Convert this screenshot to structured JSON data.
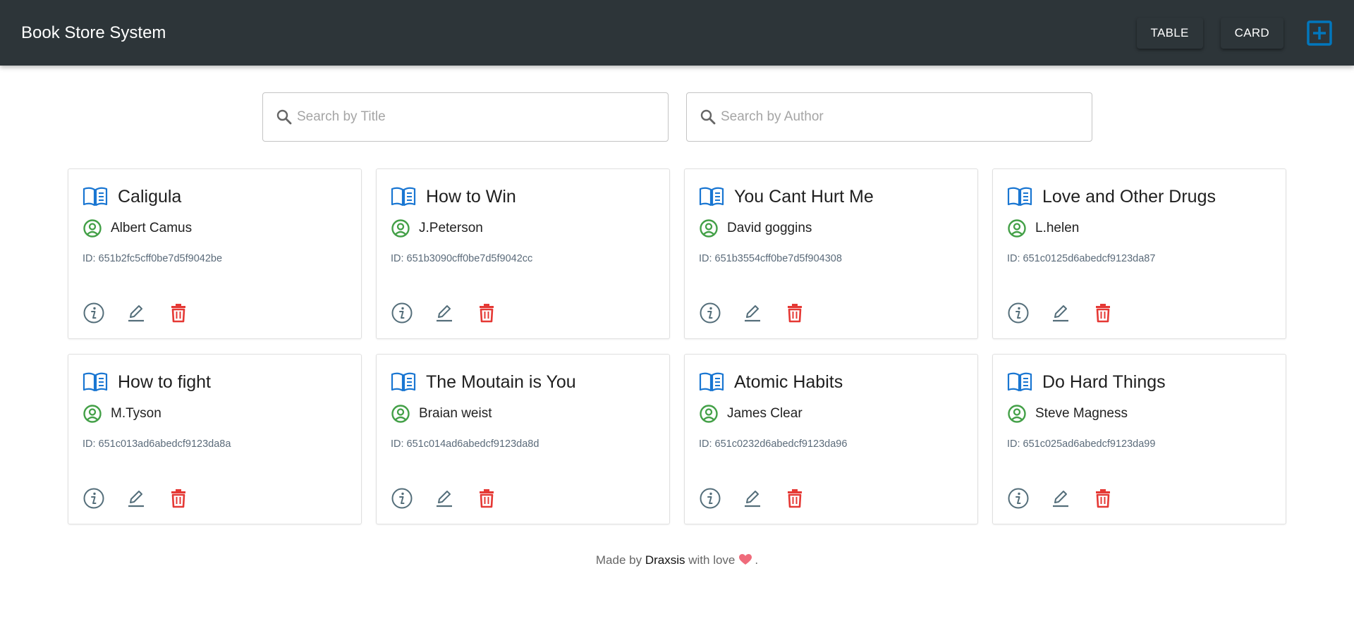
{
  "app": {
    "title": "Book Store System",
    "nav": {
      "table_label": "TABLE",
      "card_label": "CARD"
    }
  },
  "search": {
    "title_placeholder": "Search by Title",
    "author_placeholder": "Search by Author"
  },
  "books": [
    {
      "title": "Caligula",
      "author": "Albert Camus",
      "id_label": "ID:",
      "id": "651b2fc5cff0be7d5f9042be"
    },
    {
      "title": "How to Win",
      "author": "J.Peterson",
      "id_label": "ID:",
      "id": "651b3090cff0be7d5f9042cc"
    },
    {
      "title": "You Cant Hurt Me",
      "author": "David goggins",
      "id_label": "ID:",
      "id": "651b3554cff0be7d5f904308"
    },
    {
      "title": "Love and Other Drugs",
      "author": "L.helen",
      "id_label": "ID:",
      "id": "651c0125d6abedcf9123da87"
    },
    {
      "title": "How to fight",
      "author": "M.Tyson",
      "id_label": "ID:",
      "id": "651c013ad6abedcf9123da8a"
    },
    {
      "title": "The Moutain is You",
      "author": "Braian weist",
      "id_label": "ID:",
      "id": "651c014ad6abedcf9123da8d"
    },
    {
      "title": "Atomic Habits",
      "author": "James Clear",
      "id_label": "ID:",
      "id": "651c0232d6abedcf9123da96"
    },
    {
      "title": "Do Hard Things",
      "author": "Steve Magness",
      "id_label": "ID:",
      "id": "651c025ad6abedcf9123da99"
    }
  ],
  "footer": {
    "prefix": "Made by",
    "name": "Draxsis",
    "suffix": "with love",
    "end": "."
  },
  "colors": {
    "appbar": "#2d3539",
    "book_icon": "#1976d2",
    "author_icon": "#43a047",
    "info_icon": "#546e7a",
    "edit_icon": "#546e7a",
    "delete_icon": "#e53935",
    "add_icon": "#0277bd",
    "heart": "#ef6b7b"
  }
}
